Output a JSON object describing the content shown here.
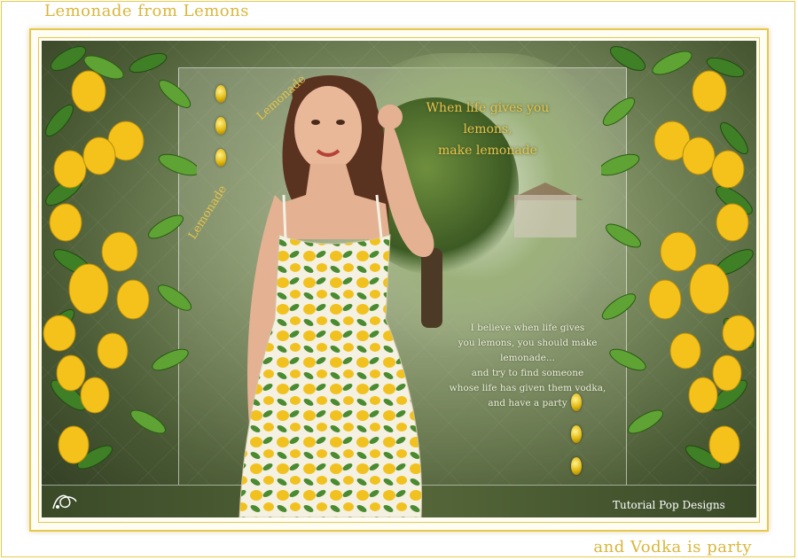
{
  "caption_top": "Lemonade from Lemons",
  "caption_bottom": "and Vodka is party",
  "headline": {
    "line1": "When life gives you lemons,",
    "line2": "make lemonade"
  },
  "poem": {
    "line1": "I believe when life gives",
    "line2": "you lemons, you should make lemonade...",
    "line3": "and try to find someone",
    "line4": "whose life has given them vodka,",
    "line5": "and have a party"
  },
  "decor_words": {
    "word1": "Lemonade",
    "word2": "Lemonade"
  },
  "watermark": "Tutorial  Pop Designs",
  "colors": {
    "border_gold": "#e7c84d",
    "caption_gold": "#d9b63a",
    "lemon_yellow": "#f4c21b",
    "leaf_green": "#3f7f26",
    "background_olive": "#6f7f50"
  },
  "icons": {
    "corner_logo": "signature-flourish-icon",
    "lemon": "lemon-icon"
  }
}
